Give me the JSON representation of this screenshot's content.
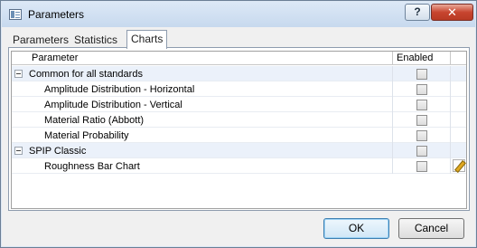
{
  "window": {
    "title": "Parameters",
    "help_label": "?",
    "close_label": "✕"
  },
  "tabs": [
    {
      "label": "Parameters",
      "active": false
    },
    {
      "label": "Statistics",
      "active": false
    },
    {
      "label": "Charts",
      "active": true
    }
  ],
  "grid": {
    "columns": {
      "parameter": "Parameter",
      "enabled": "Enabled"
    },
    "rows": [
      {
        "type": "group",
        "label": "Common for all standards",
        "enabled": false
      },
      {
        "type": "item",
        "label": "Amplitude Distribution - Horizontal",
        "enabled": false
      },
      {
        "type": "item",
        "label": "Amplitude Distribution - Vertical",
        "enabled": false
      },
      {
        "type": "item",
        "label": "Material Ratio (Abbott)",
        "enabled": false
      },
      {
        "type": "item",
        "label": "Material Probability",
        "enabled": false
      },
      {
        "type": "group",
        "label": "SPIP Classic",
        "enabled": false
      },
      {
        "type": "item",
        "label": "Roughness Bar Chart",
        "enabled": false,
        "editable": true
      }
    ]
  },
  "buttons": {
    "ok": "OK",
    "cancel": "Cancel"
  },
  "icons": {
    "app": "parameters-window-icon",
    "collapse": "collapse-icon",
    "edit": "pencil-icon"
  }
}
